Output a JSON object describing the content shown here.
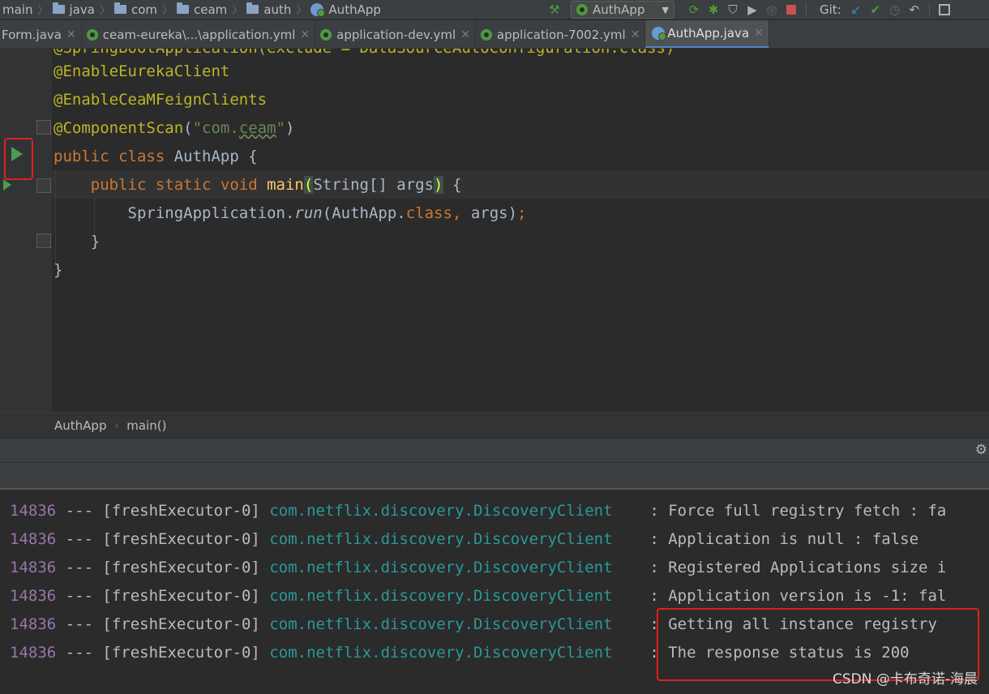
{
  "navbar": {
    "breadcrumbs": [
      "main",
      "java",
      "com",
      "ceam",
      "auth",
      "AuthApp"
    ],
    "run_config": "AuthApp",
    "git_label": "Git:"
  },
  "tabs": [
    {
      "label": "Form.java",
      "active": false
    },
    {
      "label": "ceam-eureka\\...\\application.yml",
      "active": false
    },
    {
      "label": "application-dev.yml",
      "active": false
    },
    {
      "label": "application-7002.yml",
      "active": false
    },
    {
      "label": "AuthApp.java",
      "active": true
    }
  ],
  "editor": {
    "lines": {
      "l0": "@SpringBootApplication(exclude = DataSourceAutoConfiguration.class)",
      "l1": "@EnableEurekaClient",
      "l2": "@EnableCeaMFeignClients",
      "l3_anno": "@ComponentScan",
      "l3_str_prefix": "\"com.",
      "l3_str_word": "ceam",
      "l3_str_suffix": "\"",
      "l4_kw": "public class ",
      "l4_name": "AuthApp {",
      "l5_kw": "public static void ",
      "l5_method": "main",
      "l5_args": "String[] args",
      "l6_prefix": "SpringApplication.",
      "l6_method": "run",
      "l6_arg": "AuthApp.",
      "l6_kw": "class",
      "l6_rest": "args",
      "l7": "}",
      "l8": "}"
    }
  },
  "editor_breadcrumbs": [
    "AuthApp",
    "main()"
  ],
  "console": {
    "lines": [
      {
        "pid": "14836",
        "thread": " --- [freshExecutor-0] ",
        "cls": "com.netflix.discovery.DiscoveryClient",
        "msg": "    : Force full registry fetch : fa"
      },
      {
        "pid": "14836",
        "thread": " --- [freshExecutor-0] ",
        "cls": "com.netflix.discovery.DiscoveryClient",
        "msg": "    : Application is null : false"
      },
      {
        "pid": "14836",
        "thread": " --- [freshExecutor-0] ",
        "cls": "com.netflix.discovery.DiscoveryClient",
        "msg": "    : Registered Applications size i"
      },
      {
        "pid": "14836",
        "thread": " --- [freshExecutor-0] ",
        "cls": "com.netflix.discovery.DiscoveryClient",
        "msg": "    : Application version is -1: fal"
      },
      {
        "pid": "14836",
        "thread": " --- [freshExecutor-0] ",
        "cls": "com.netflix.discovery.DiscoveryClient",
        "msg": "    : Getting all instance registry"
      },
      {
        "pid": "14836",
        "thread": " --- [freshExecutor-0] ",
        "cls": "com.netflix.discovery.DiscoveryClient",
        "msg": "    : The response status is 200"
      }
    ]
  },
  "watermark": "CSDN @卡布奇诺-海晨",
  "colors": {
    "highlight_box": "#e02020",
    "run_green": "#499c54",
    "annotation": "#bbb529",
    "keyword": "#cc7832",
    "log_class": "#299999"
  }
}
